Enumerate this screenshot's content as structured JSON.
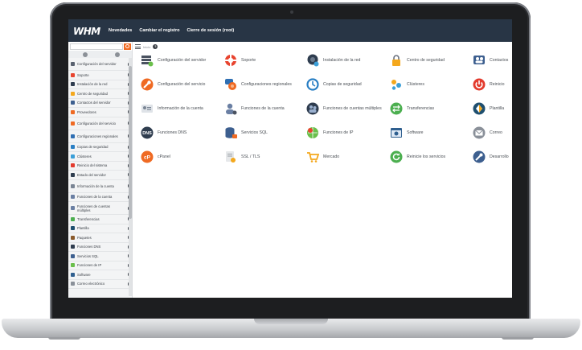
{
  "app": {
    "logo": "WHM",
    "nav": [
      "Novedades",
      "Cambiar el registro",
      "Cierre de sesión (root)"
    ]
  },
  "sidebar": {
    "items": [
      {
        "label": "Configuración del servidor",
        "color": "#5a6270"
      },
      {
        "label": "Soporte",
        "color": "#e8442f"
      },
      {
        "label": "Instalación de la red",
        "color": "#2f3d4f"
      },
      {
        "label": "Centro de seguridad",
        "color": "#f4a81d"
      },
      {
        "label": "Contactos del servidor",
        "color": "#3d5f8f"
      },
      {
        "label": "Proveedores",
        "color": "#ef6a23"
      },
      {
        "label": "Configuración del servicio",
        "color": "#ef6a23"
      },
      {
        "label": "Configuraciones regionales",
        "color": "#2f6fb3"
      },
      {
        "label": "Copias de seguridad",
        "color": "#2a7fc4"
      },
      {
        "label": "Clústeres",
        "color": "#3b9fd8"
      },
      {
        "label": "Reinicio del sistema",
        "color": "#e33b2e"
      },
      {
        "label": "Estado del servidor",
        "color": "#2f3d4f"
      },
      {
        "label": "Información de la cuenta",
        "color": "#7a8594"
      },
      {
        "label": "Funciones de la cuenta",
        "color": "#6a7fa3"
      },
      {
        "label": "Funciones de cuentas múltiples",
        "color": "#6a7fa3"
      },
      {
        "label": "Transferencias",
        "color": "#4caf50"
      },
      {
        "label": "Plantilla",
        "color": "#1f4f6f"
      },
      {
        "label": "Paquetes",
        "color": "#8a5a2b"
      },
      {
        "label": "Funciones DNS",
        "color": "#2f3d4f"
      },
      {
        "label": "Servicios SQL",
        "color": "#3d5f8f"
      },
      {
        "label": "Funciones de IP",
        "color": "#6abf4b"
      },
      {
        "label": "Software",
        "color": "#2f5f8f"
      },
      {
        "label": "Correo electrónico",
        "color": "#8a9099"
      }
    ]
  },
  "main": {
    "breadcrumb": "Inicio",
    "help_icon": "?",
    "tiles": [
      {
        "label": "Configuración del servidor",
        "icon": "server-config-icon"
      },
      {
        "label": "Soporte",
        "icon": "lifebuoy-icon"
      },
      {
        "label": "Instalación de la red",
        "icon": "network-icon"
      },
      {
        "label": "Centro de seguridad",
        "icon": "lock-icon"
      },
      {
        "label": "Contactos",
        "icon": "contacts-icon"
      },
      {
        "label": "Configuración del servicio",
        "icon": "wrench-icon"
      },
      {
        "label": "Configuraciones regionales",
        "icon": "globe-chat-icon"
      },
      {
        "label": "Copias de seguridad",
        "icon": "backup-icon"
      },
      {
        "label": "Clústeres",
        "icon": "cluster-icon"
      },
      {
        "label": "Reinicio",
        "icon": "power-icon"
      },
      {
        "label": "Información de la cuenta",
        "icon": "id-card-icon"
      },
      {
        "label": "Funciones de la cuenta",
        "icon": "user-gear-icon"
      },
      {
        "label": "Funciones de cuentas múltiples",
        "icon": "users-icon"
      },
      {
        "label": "Transferencias",
        "icon": "transfer-icon"
      },
      {
        "label": "Plantilla",
        "icon": "theme-icon"
      },
      {
        "label": "Funciones DNS",
        "icon": "dns-icon"
      },
      {
        "label": "Servicios SQL",
        "icon": "database-icon"
      },
      {
        "label": "Funciones de IP",
        "icon": "ip-globe-icon"
      },
      {
        "label": "Software",
        "icon": "software-icon"
      },
      {
        "label": "Correo",
        "icon": "mail-icon"
      },
      {
        "label": "cPanel",
        "icon": "cpanel-icon"
      },
      {
        "label": "SSL / TLS",
        "icon": "certificate-icon"
      },
      {
        "label": "Mercado",
        "icon": "cart-icon"
      },
      {
        "label": "Reinicie los servicios",
        "icon": "restart-icon"
      },
      {
        "label": "Desarrollo",
        "icon": "developer-icon"
      }
    ]
  },
  "colors": {
    "topbar": "#283545",
    "accent": "#ef6a23"
  }
}
